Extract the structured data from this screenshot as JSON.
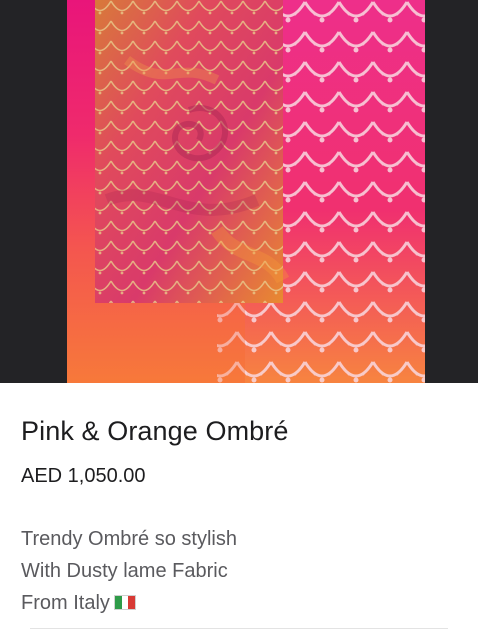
{
  "product": {
    "title": "Pink & Orange Ombré",
    "price": "AED 1,050.00",
    "description": [
      "Trendy Ombré so stylish",
      "With Dusty lame Fabric",
      "From Italy"
    ],
    "origin_flag_icon": "italy-flag-emoji",
    "image_icon": "fabric-photo"
  },
  "colors": {
    "hero_background": "#232326",
    "pink": "#e9157a",
    "orange": "#f7793a"
  }
}
